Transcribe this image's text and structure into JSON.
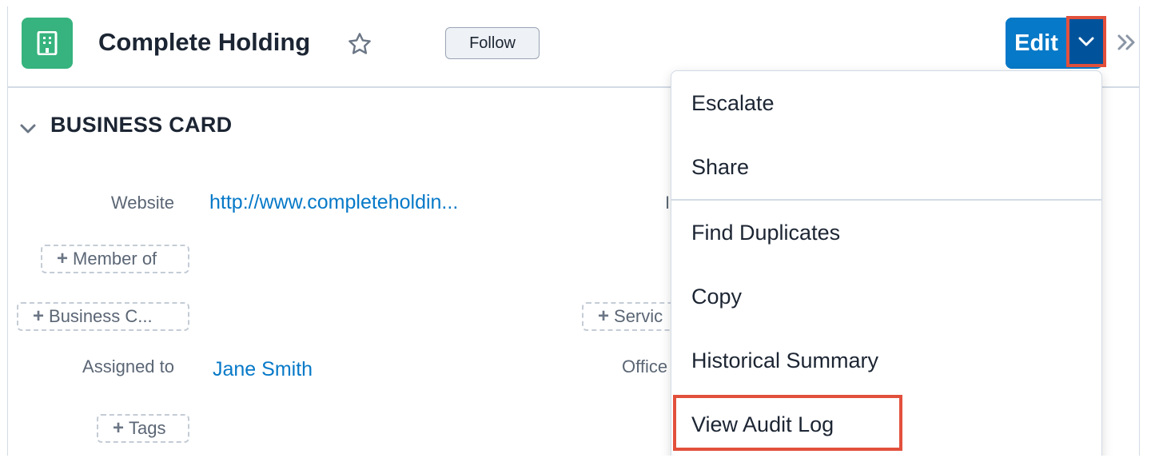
{
  "header": {
    "title": "Complete Holding",
    "follow_label": "Follow",
    "edit_label": "Edit"
  },
  "panel": {
    "title": "BUSINESS CARD"
  },
  "fields": {
    "website_label": "Website",
    "website_value": "http://www.completeholdin...",
    "member_of_label": "Member of",
    "business_center_label": "Business C...",
    "service_label": "Servic",
    "truncated_label": "I",
    "assigned_to_label": "Assigned to",
    "assigned_to_value": "Jane Smith",
    "office_label": "Office",
    "tags_label": "Tags"
  },
  "dropdown": {
    "items": [
      {
        "label": "Escalate"
      },
      {
        "label": "Share"
      },
      {
        "label": "Find Duplicates"
      },
      {
        "label": "Copy"
      },
      {
        "label": "Historical Summary"
      },
      {
        "label": "View Audit Log"
      }
    ]
  },
  "colors": {
    "accent": "#0679c8",
    "accent_dark": "#00539b",
    "module": "#36b37e",
    "highlight": "#e2503c"
  },
  "icons": {
    "module": "building-icon",
    "favorite": "star-icon",
    "caret": "chevron-down-icon",
    "collapse": "double-chevron-right-icon",
    "panel_toggle": "chevron-down-icon"
  }
}
